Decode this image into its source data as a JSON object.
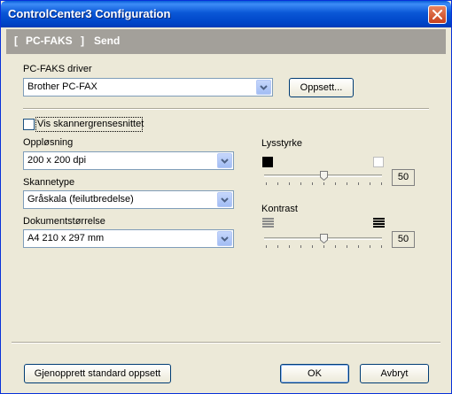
{
  "window": {
    "title": "ControlCenter3 Configuration"
  },
  "header": {
    "bracket_open": "[",
    "section": "PC-FAKS",
    "bracket_close": "]",
    "action": "Send"
  },
  "driver": {
    "label": "PC-FAKS driver",
    "value": "Brother PC-FAX",
    "setup_button": "Oppsett..."
  },
  "scanner_interface": {
    "label": "Vis skannergrensesnittet",
    "checked": false
  },
  "resolution": {
    "label": "Oppløsning",
    "value": "200 x 200 dpi"
  },
  "scan_type": {
    "label": "Skannetype",
    "value": "Gråskala (feilutbredelse)"
  },
  "document_size": {
    "label": "Dokumentstørrelse",
    "value": "A4 210 x 297 mm"
  },
  "brightness": {
    "label": "Lysstyrke",
    "value": "50"
  },
  "contrast": {
    "label": "Kontrast",
    "value": "50"
  },
  "footer": {
    "restore_button": "Gjenopprett standard oppsett",
    "ok_button": "OK",
    "cancel_button": "Avbryt"
  }
}
